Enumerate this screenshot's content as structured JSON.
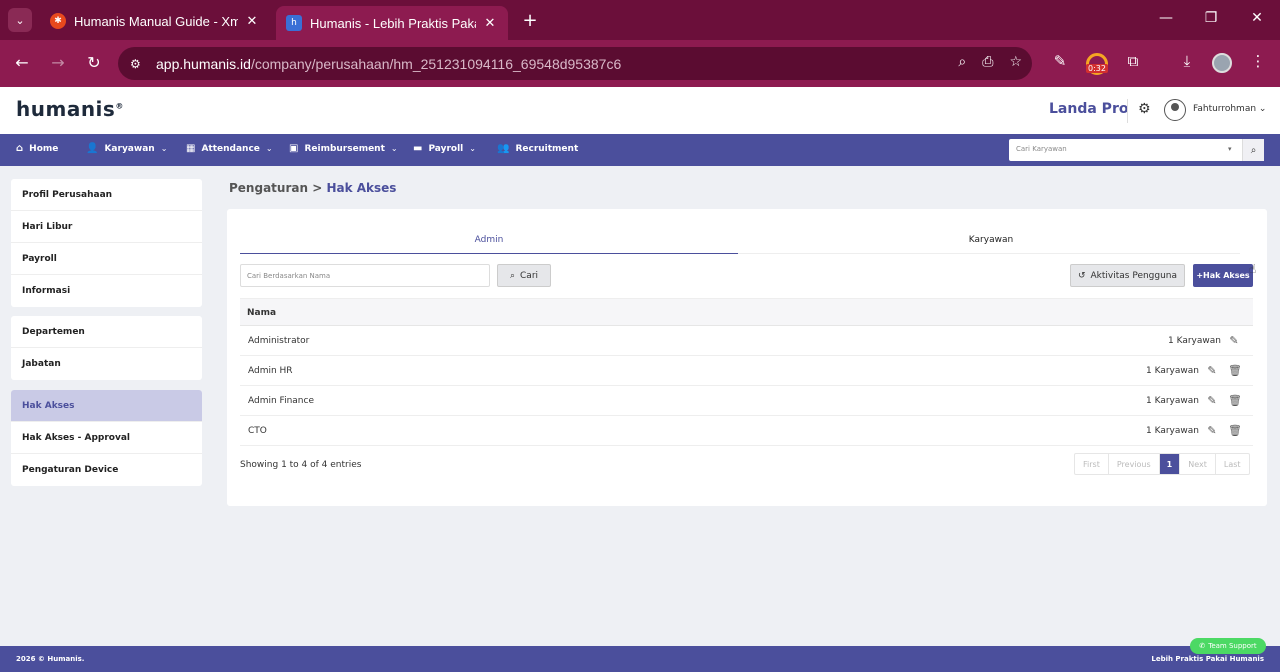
{
  "browser": {
    "tabs": [
      {
        "title": "Humanis Manual Guide - Xmind",
        "close": "✕"
      },
      {
        "title": "Humanis - Lebih Praktis Pakai Humanis",
        "close": "✕"
      }
    ],
    "new_tab": "+",
    "url_host": "app.humanis.id",
    "url_path": "/company/perusahaan/hm_251231094116_69548d95387c6",
    "extension_timer": "0:32"
  },
  "header": {
    "logo": "humanis",
    "plan": "Landa Pro",
    "user_name": "Fahturrohman"
  },
  "nav": {
    "items": [
      {
        "label": "Home",
        "chevron": ""
      },
      {
        "label": "Karyawan",
        "chevron": "⌄"
      },
      {
        "label": "Attendance",
        "chevron": "⌄"
      },
      {
        "label": "Reimbursement",
        "chevron": "⌄"
      },
      {
        "label": "Payroll",
        "chevron": "⌄"
      },
      {
        "label": "Recruitment",
        "chevron": ""
      }
    ],
    "search_placeholder": "Cari Karyawan"
  },
  "sidebar": {
    "group1": [
      "Profil Perusahaan",
      "Hari Libur",
      "Payroll",
      "Informasi"
    ],
    "group2": [
      "Departemen",
      "Jabatan"
    ],
    "group3": [
      "Hak Akses",
      "Hak Akses - Approval",
      "Pengaturan Device"
    ],
    "active": "Hak Akses"
  },
  "breadcrumb": {
    "parent": "Pengaturan",
    "sep": ">",
    "current": "Hak Akses"
  },
  "content": {
    "tabs": [
      "Admin",
      "Karyawan"
    ],
    "active_tab": "Admin",
    "search_placeholder": "Cari Berdasarkan Nama",
    "search_button": "Cari",
    "activity_button": "Aktivitas Pengguna",
    "add_button": "+Hak Akses",
    "column_name": "Nama",
    "rows": [
      {
        "name": "Administrator",
        "count": "1 Karyawan",
        "deletable": false
      },
      {
        "name": "Admin HR",
        "count": "1 Karyawan",
        "deletable": true
      },
      {
        "name": "Admin Finance",
        "count": "1 Karyawan",
        "deletable": true
      },
      {
        "name": "CTO",
        "count": "1 Karyawan",
        "deletable": true
      }
    ],
    "showing": "Showing 1 to 4 of 4 entries",
    "pager": [
      "First",
      "Previous",
      "1",
      "Next",
      "Last"
    ]
  },
  "footer": {
    "left": "2026 © Humanis.",
    "right": "Lebih Praktis Pakai Humanis",
    "support": "Team Support"
  },
  "colors": {
    "brand": "#4b4f9c",
    "chrome": "#8d1b50",
    "support": "#4cd964"
  }
}
